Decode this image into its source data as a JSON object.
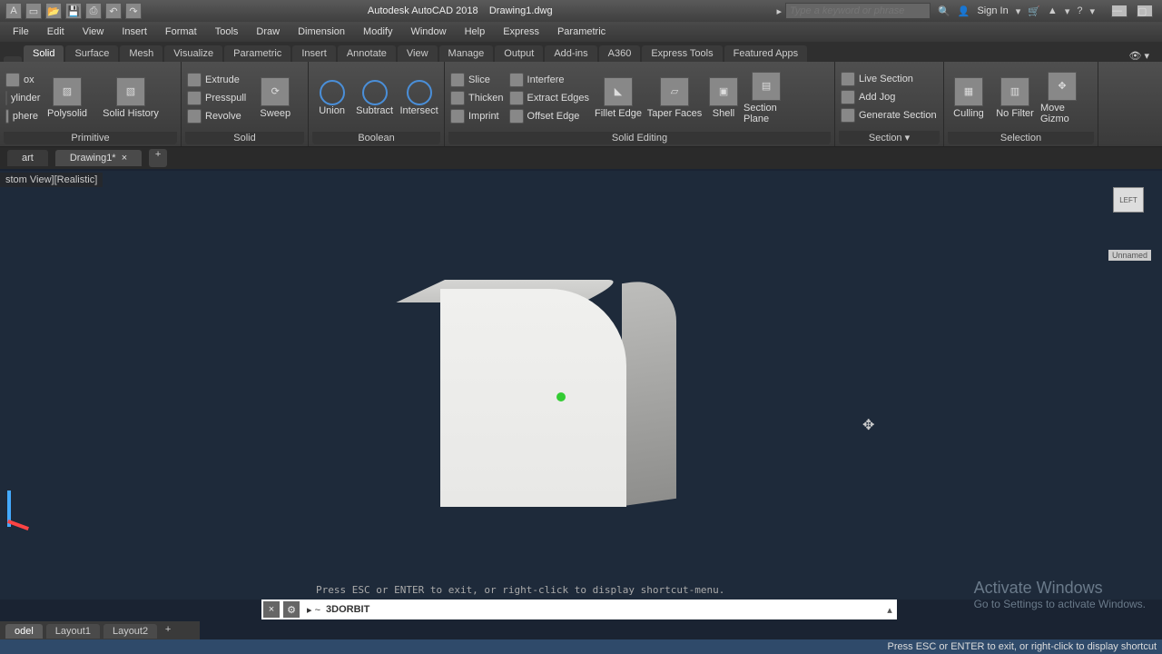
{
  "titlebar": {
    "app": "Autodesk AutoCAD 2018",
    "file": "Drawing1.dwg",
    "search_placeholder": "Type a keyword or phrase",
    "signin": "Sign In"
  },
  "menus": [
    "File",
    "Edit",
    "View",
    "Insert",
    "Format",
    "Tools",
    "Draw",
    "Dimension",
    "Modify",
    "Window",
    "Help",
    "Express",
    "Parametric"
  ],
  "tabs": [
    "",
    "Solid",
    "Surface",
    "Mesh",
    "Visualize",
    "Parametric",
    "Insert",
    "Annotate",
    "View",
    "Manage",
    "Output",
    "Add-ins",
    "A360",
    "Express Tools",
    "Featured Apps"
  ],
  "active_tab_index": 1,
  "ribbon": {
    "primitive": {
      "title": "Primitive",
      "big": [
        {
          "label": "Polysolid"
        },
        {
          "label": "Solid History"
        }
      ],
      "side": [
        "ox",
        "ylinder",
        "phere"
      ]
    },
    "solid": {
      "title": "Solid",
      "big": [
        {
          "label": "Sweep"
        }
      ],
      "small": [
        "Extrude",
        "Presspull",
        "Revolve"
      ]
    },
    "boolean": {
      "title": "Boolean",
      "big": [
        {
          "label": "Union"
        },
        {
          "label": "Subtract"
        },
        {
          "label": "Intersect"
        }
      ]
    },
    "solid_editing": {
      "title": "Solid Editing",
      "col1": [
        "Slice",
        "Thicken",
        "Imprint"
      ],
      "col2": [
        "Interfere",
        "Extract Edges",
        "Offset Edge"
      ],
      "big": [
        {
          "label": "Fillet Edge"
        },
        {
          "label": "Taper Faces"
        },
        {
          "label": "Shell"
        },
        {
          "label": "Section Plane"
        }
      ]
    },
    "section": {
      "title": "Section",
      "small": [
        "Live Section",
        "Add Jog",
        "Generate Section"
      ]
    },
    "selection": {
      "title": "Selection",
      "big": [
        {
          "label": "Culling"
        },
        {
          "label": "No Filter"
        },
        {
          "label": "Move Gizmo"
        }
      ]
    }
  },
  "filetabs": {
    "start": "art",
    "drawing": "Drawing1*"
  },
  "viewport_label": "stom View][Realistic]",
  "viewcube": {
    "face": "LEFT",
    "label": "Unnamed"
  },
  "cmd": {
    "hint": "Press ESC or ENTER to exit, or right-click to display shortcut-menu.",
    "prefix": "▸ ~",
    "command": "3DORBIT"
  },
  "watermark": {
    "title": "Activate Windows",
    "sub": "Go to Settings to activate Windows."
  },
  "bottom_tabs": [
    "odel",
    "Layout1",
    "Layout2"
  ],
  "status": "Press ESC or ENTER to exit, or right-click to display shortcut"
}
